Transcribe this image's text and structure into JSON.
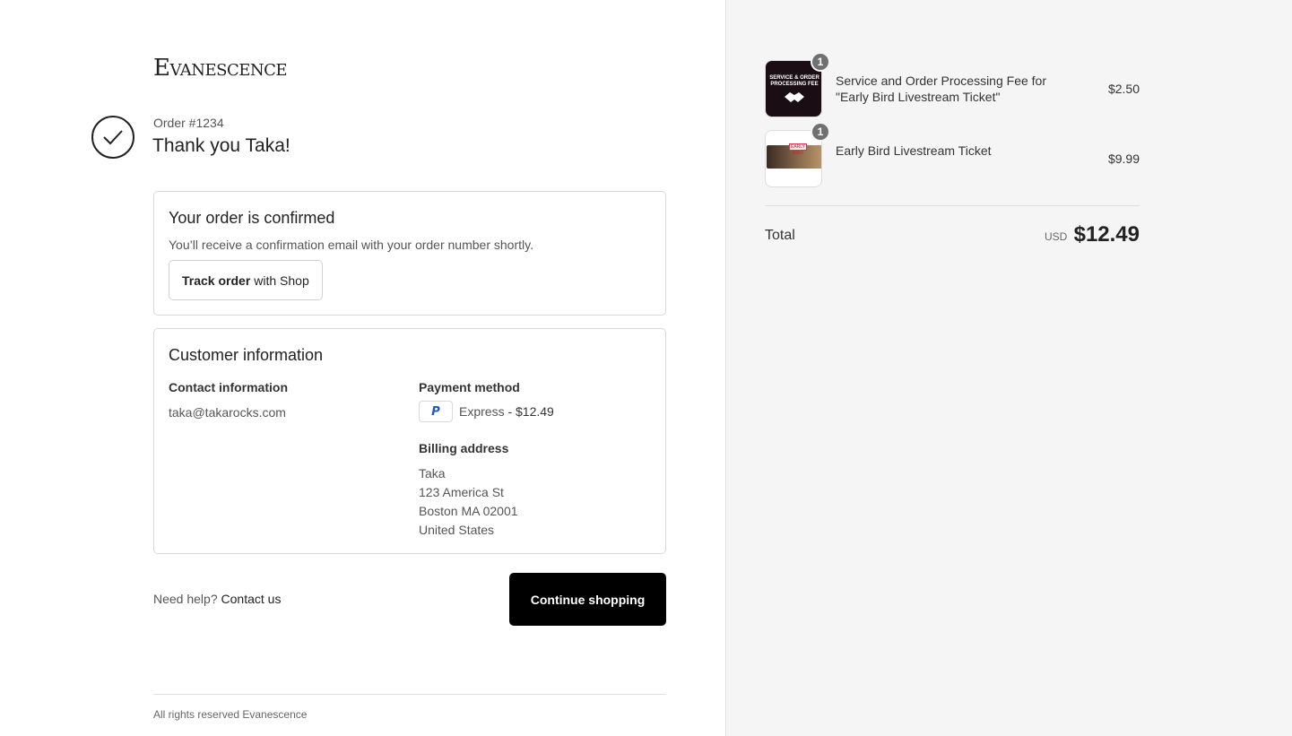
{
  "brand": {
    "logo_text": "Evanescence"
  },
  "order": {
    "number": "Order #1234",
    "thanks": "Thank you Taka!"
  },
  "confirmed": {
    "title": "Your order is confirmed",
    "subtitle": "You’ll receive a confirmation email with your order number shortly.",
    "track_bold": "Track order",
    "track_rest": "with Shop"
  },
  "customer": {
    "title": "Customer information",
    "contact_label": "Contact information",
    "email": "taka@takarocks.com",
    "payment_label": "Payment method",
    "payment_method": "Express",
    "payment_amount": "- $12.49",
    "payment_icon": "paypal-icon",
    "billing_label": "Billing address",
    "billing_lines": [
      "Taka",
      "123 America St",
      "Boston MA 02001",
      "United States"
    ]
  },
  "help": {
    "text": "Need help?",
    "link": "Contact us"
  },
  "continue_label": "Continue shopping",
  "footer": "All rights reserved Evanescence",
  "cart": {
    "items": [
      {
        "qty": "1",
        "name": "Service and Order Processing Fee for \"Early Bird Livestream Ticket\"",
        "price": "$2.50",
        "thumb_text": "SERVICE & ORDER PROCESSING FEE"
      },
      {
        "qty": "1",
        "name": "Early Bird Livestream Ticket",
        "price": "$9.99",
        "thumb_text": "EARLY BIRD"
      }
    ],
    "total_label": "Total",
    "currency": "USD",
    "total": "$12.49"
  },
  "colors": {
    "accent": "#000000",
    "sidebar_bg": "#f5f5f5",
    "paypal": "#1f5ab4"
  }
}
